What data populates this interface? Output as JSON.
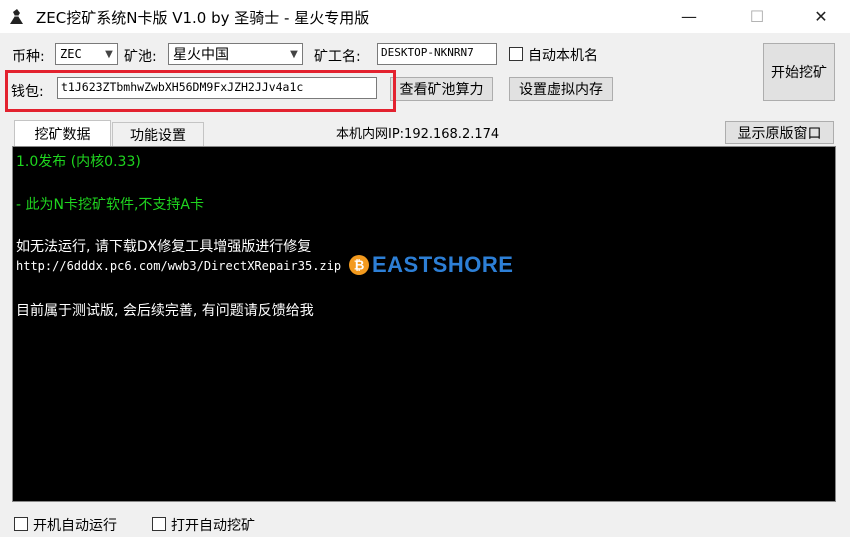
{
  "window": {
    "title": "ZEC挖矿系统N卡版 V1.0  by 圣骑士 - 星火专用版",
    "minimize_glyph": "—",
    "maximize_glyph": "☐",
    "close_glyph": "✕"
  },
  "form": {
    "coin_label": "币种:",
    "coin_value": "ZEC",
    "pool_label": "矿池:",
    "pool_value": "星火中国",
    "worker_label": "矿工名:",
    "worker_value": "DESKTOP-NKNRN7",
    "auto_name_label": "自动本机名",
    "wallet_label": "钱包:",
    "wallet_value": "t1J623ZTbmhwZwbXH56DM9FxJZH2JJv4a1c",
    "pool_hashrate_button": "查看矿池算力",
    "virtual_memory_button": "设置虚拟内存",
    "start_button": "开始挖矿"
  },
  "tabs": {
    "mining_data": "挖矿数据",
    "settings": "功能设置"
  },
  "local_ip": "本机内网IP:192.168.2.174",
  "original_window_button": "显示原版窗口",
  "console": {
    "line1": "1.0发布 (内核0.33)",
    "line2": "- 此为N卡挖矿软件,不支持A卡",
    "line3": "如无法运行, 请下载DX修复工具增强版进行修复",
    "line4": "http://6dddx.pc6.com/wwb3/DirectXRepair35.zip",
    "line5": "目前属于测试版, 会后续完善, 有问题请反馈给我",
    "watermark": "EASTSHORE"
  },
  "footer": {
    "autorun_label": "开机自动运行",
    "automine_label": "打开自动挖矿"
  },
  "colors": {
    "console_bg": "#000000",
    "console_green": "#1fd61f",
    "console_white": "#ffffff",
    "highlight_red": "#e3222f",
    "watermark_blue": "#2d7fd6",
    "watermark_orange": "#f39a1e"
  }
}
